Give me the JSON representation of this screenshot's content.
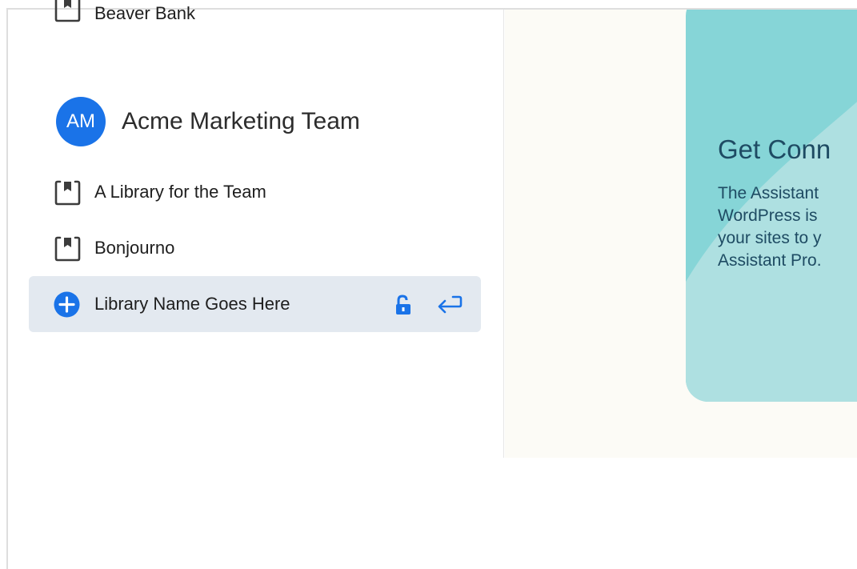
{
  "sidebar": {
    "partial_item": {
      "label": "Beaver Bank",
      "icon": "book-icon"
    },
    "team": {
      "avatar_initials": "AM",
      "name": "Acme Marketing Team",
      "avatar_color": "#1a73e8"
    },
    "items": [
      {
        "label": "A Library for the Team",
        "icon": "book-icon"
      },
      {
        "label": "Bonjourno",
        "icon": "book-icon"
      }
    ],
    "new_library": {
      "label": "Library Name Goes Here",
      "icon": "plus-circle-icon",
      "lock_icon": "unlock-icon",
      "submit_icon": "enter-icon",
      "accent": "#1a73e8"
    }
  },
  "promo": {
    "title": "Get Conn",
    "body": "The Assistant\nWordPress is\nyour sites to y\nAssistant Pro.",
    "background": "#86d5d7",
    "text_color": "#1e4b63"
  }
}
